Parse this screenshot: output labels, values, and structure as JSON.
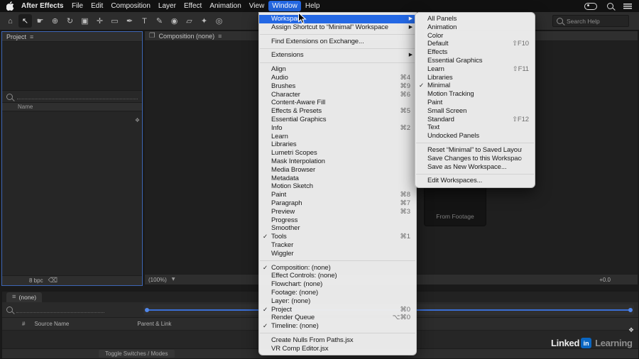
{
  "menubar": {
    "app_name": "After Effects",
    "menus": [
      {
        "name": "menu-file",
        "label": "File"
      },
      {
        "name": "menu-edit",
        "label": "Edit"
      },
      {
        "name": "menu-composition",
        "label": "Composition"
      },
      {
        "name": "menu-layer",
        "label": "Layer"
      },
      {
        "name": "menu-effect",
        "label": "Effect"
      },
      {
        "name": "menu-animation",
        "label": "Animation"
      },
      {
        "name": "menu-view",
        "label": "View"
      },
      {
        "name": "menu-window",
        "label": "Window",
        "active": true
      },
      {
        "name": "menu-help",
        "label": "Help"
      }
    ]
  },
  "window_menu": {
    "items": [
      {
        "label": "Workspace",
        "submenu": true,
        "highlighted": true
      },
      {
        "label": "Assign Shortcut to “Minimal” Workspace",
        "submenu": true
      },
      {
        "separator": true
      },
      {
        "label": "Find Extensions on Exchange..."
      },
      {
        "separator": true
      },
      {
        "label": "Extensions",
        "submenu": true
      },
      {
        "separator": true
      },
      {
        "label": "Align"
      },
      {
        "label": "Audio",
        "shortcut": "⌘4"
      },
      {
        "label": "Brushes",
        "shortcut": "⌘9"
      },
      {
        "label": "Character",
        "shortcut": "⌘6"
      },
      {
        "label": "Content-Aware Fill"
      },
      {
        "label": "Effects & Presets",
        "shortcut": "⌘5"
      },
      {
        "label": "Essential Graphics"
      },
      {
        "label": "Info",
        "shortcut": "⌘2"
      },
      {
        "label": "Learn"
      },
      {
        "label": "Libraries"
      },
      {
        "label": "Lumetri Scopes"
      },
      {
        "label": "Mask Interpolation"
      },
      {
        "label": "Media Browser"
      },
      {
        "label": "Metadata"
      },
      {
        "label": "Motion Sketch"
      },
      {
        "label": "Paint",
        "shortcut": "⌘8"
      },
      {
        "label": "Paragraph",
        "shortcut": "⌘7"
      },
      {
        "label": "Preview",
        "shortcut": "⌘3"
      },
      {
        "label": "Progress"
      },
      {
        "label": "Smoother"
      },
      {
        "label": "Tools",
        "shortcut": "⌘1",
        "checked": true
      },
      {
        "label": "Tracker"
      },
      {
        "label": "Wiggler"
      },
      {
        "separator": true
      },
      {
        "label": "Composition: (none)",
        "checked": true
      },
      {
        "label": "Effect Controls: (none)"
      },
      {
        "label": "Flowchart: (none)"
      },
      {
        "label": "Footage: (none)"
      },
      {
        "label": "Layer: (none)"
      },
      {
        "label": "Project",
        "shortcut": "⌘0",
        "checked": true
      },
      {
        "label": "Render Queue",
        "shortcut": "⌥⌘0"
      },
      {
        "label": "Timeline: (none)",
        "checked": true
      },
      {
        "separator": true
      },
      {
        "label": "Create Nulls From Paths.jsx"
      },
      {
        "label": "VR Comp Editor.jsx"
      }
    ]
  },
  "workspace_submenu": {
    "items": [
      {
        "label": "All Panels"
      },
      {
        "label": "Animation"
      },
      {
        "label": "Color"
      },
      {
        "label": "Default",
        "shortcut": "⇧F10"
      },
      {
        "label": "Effects"
      },
      {
        "label": "Essential Graphics"
      },
      {
        "label": "Learn",
        "shortcut": "⇧F11"
      },
      {
        "label": "Libraries"
      },
      {
        "label": "Minimal",
        "checked": true
      },
      {
        "label": "Motion Tracking"
      },
      {
        "label": "Paint"
      },
      {
        "label": "Small Screen"
      },
      {
        "label": "Standard",
        "shortcut": "⇧F12"
      },
      {
        "label": "Text"
      },
      {
        "label": "Undocked Panels"
      },
      {
        "separator": true
      },
      {
        "label": "Reset “Minimal” to Saved Layout"
      },
      {
        "label": "Save Changes to this Workspace"
      },
      {
        "label": "Save as New Workspace..."
      },
      {
        "separator": true
      },
      {
        "label": "Edit Workspaces..."
      }
    ]
  },
  "toolbar": {
    "tools": [
      {
        "name": "home-tool",
        "glyph": "⌂"
      },
      {
        "name": "selection-tool",
        "glyph": "↖",
        "active": true
      },
      {
        "name": "hand-tool",
        "glyph": "☛"
      },
      {
        "name": "zoom-tool",
        "glyph": "⊕"
      },
      {
        "name": "orbit-camera-tool",
        "glyph": "↻"
      },
      {
        "name": "camera-tool",
        "glyph": "▣"
      },
      {
        "name": "pan-behind-tool",
        "glyph": "✛"
      },
      {
        "name": "shape-tool",
        "glyph": "▭"
      },
      {
        "name": "pen-tool",
        "glyph": "✒"
      },
      {
        "name": "type-tool",
        "glyph": "T"
      },
      {
        "name": "brush-tool",
        "glyph": "✎"
      },
      {
        "name": "clone-stamp-tool",
        "glyph": "◉"
      },
      {
        "name": "eraser-tool",
        "glyph": "▱"
      },
      {
        "name": "roto-brush-tool",
        "glyph": "✦"
      },
      {
        "name": "puppet-pin-tool",
        "glyph": "◎"
      }
    ],
    "mid_icons": [
      {
        "name": "snapping-icon",
        "glyph": "▦"
      },
      {
        "name": "grid-options-icon",
        "glyph": "✚"
      }
    ],
    "right_icons": [
      {
        "name": "workspace-panel-icon",
        "glyph": "▤"
      },
      {
        "name": "shared-view-icon",
        "glyph": "▥"
      }
    ],
    "search_help": "Search Help"
  },
  "project": {
    "title": "Project",
    "name_column": "Name",
    "bit_depth": "8 bpc",
    "footer_icons": [
      {
        "name": "interpret-footage-icon",
        "glyph": "◩"
      },
      {
        "name": "new-folder-icon",
        "glyph": "▤"
      },
      {
        "name": "new-composition-icon",
        "glyph": "▦"
      }
    ]
  },
  "comp": {
    "title": "Composition (none)",
    "magnification": "(100%)",
    "exposure": "+0.0",
    "from_footage": "From Footage",
    "footer_left_icons": [
      {
        "name": "snapshot-icon",
        "glyph": "◫"
      },
      {
        "name": "grid-guides-icon",
        "glyph": "⊞"
      },
      {
        "name": "mask-visibility-icon",
        "glyph": "◔"
      },
      {
        "name": "show-channel-icon",
        "glyph": "◕"
      },
      {
        "name": "region-of-interest-icon",
        "glyph": "▫"
      },
      {
        "name": "transparency-grid-icon",
        "glyph": "▩"
      }
    ],
    "footer_right_icons": [
      {
        "name": "fast-previews-icon",
        "glyph": "◫"
      },
      {
        "name": "frame-blend-icon",
        "glyph": "▦"
      },
      {
        "name": "exposure-icon",
        "glyph": "✛"
      }
    ]
  },
  "timeline": {
    "tab_label": "(none)",
    "hash_column": "#",
    "source_name": "Source Name",
    "parent_link": "Parent & Link",
    "toggle_label": "Toggle Switches / Modes",
    "comp_icons": [
      {
        "name": "mini-flowchart-icon",
        "glyph": "∴"
      },
      {
        "name": "draft-3d-icon",
        "glyph": "◇"
      },
      {
        "name": "hide-shy-icon",
        "glyph": "◌"
      },
      {
        "name": "frame-blending-icon",
        "glyph": "▩"
      },
      {
        "name": "motion-blur-icon",
        "glyph": "◐"
      },
      {
        "name": "graph-editor-icon",
        "glyph": "∿"
      }
    ],
    "av_icons": [
      {
        "name": "video-eye-icon",
        "glyph": "◉"
      },
      {
        "name": "audio-icon",
        "glyph": "◀"
      },
      {
        "name": "solo-icon",
        "glyph": "○"
      },
      {
        "name": "lock-icon",
        "glyph": "⊘"
      }
    ],
    "switch_icons": [
      {
        "name": "shy-icon",
        "glyph": "◍"
      },
      {
        "name": "collapse-icon",
        "glyph": "✦"
      },
      {
        "name": "quality-icon",
        "glyph": "\\"
      },
      {
        "name": "effects-icon",
        "glyph": "ƒ"
      },
      {
        "name": "frame-blend-icon",
        "glyph": "▩"
      },
      {
        "name": "motion-blur-icon",
        "glyph": "◐"
      }
    ],
    "footer_icons": [
      {
        "name": "expand-columns-icon",
        "glyph": "◧"
      },
      {
        "name": "expand-inout-icon",
        "glyph": "◨"
      },
      {
        "name": "transform-toggle-icon",
        "glyph": "◩"
      }
    ]
  },
  "icons": {
    "panel_menu": "≡",
    "tri_down": "▾",
    "delete": "⌫",
    "comp_tab": "❐",
    "corner": "❖",
    "edge": "❖"
  },
  "watermark": {
    "linked": "Linked",
    "in": "in",
    "learning": "Learning"
  }
}
